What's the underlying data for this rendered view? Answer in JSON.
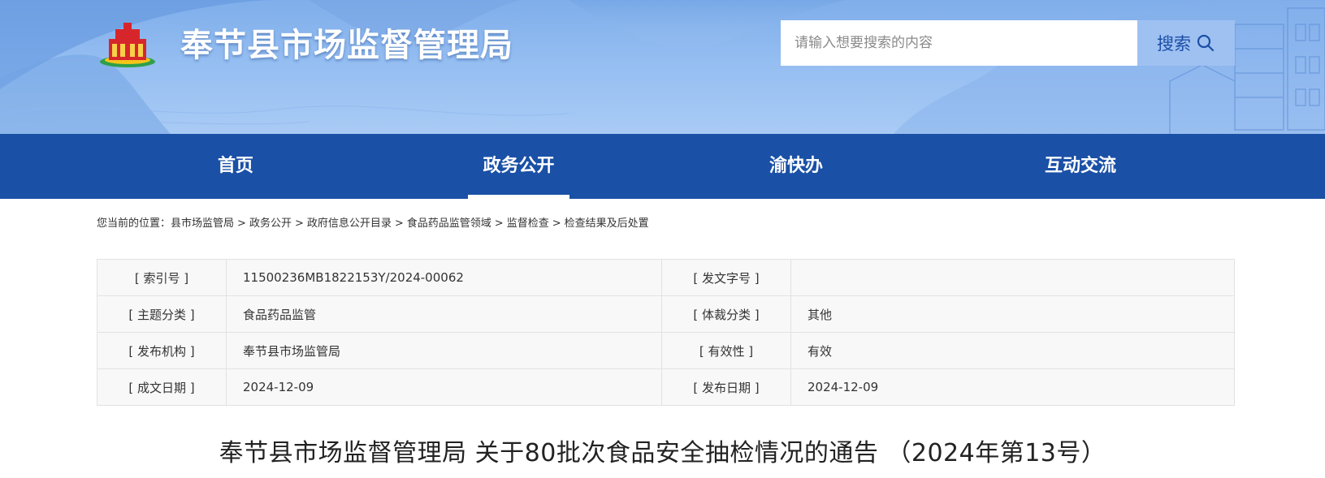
{
  "site": {
    "title": "奉节县市场监督管理局"
  },
  "search": {
    "placeholder": "请输入想要搜索的内容",
    "button_label": "搜索"
  },
  "nav": {
    "items": [
      {
        "label": "首页",
        "active": false
      },
      {
        "label": "政务公开",
        "active": true
      },
      {
        "label": "渝快办",
        "active": false
      },
      {
        "label": "互动交流",
        "active": false
      }
    ]
  },
  "breadcrumb": {
    "prefix": "您当前的位置：",
    "items": [
      "县市场监管局",
      "政务公开",
      "政府信息公开目录",
      "食品药品监管领域",
      "监督检查",
      "检查结果及后处置"
    ],
    "separator": ">"
  },
  "meta": {
    "rows": [
      {
        "label1": "[ 索引号 ]",
        "value1": "11500236MB1822153Y/2024-00062",
        "label2": "[ 发文字号 ]",
        "value2": ""
      },
      {
        "label1": "[ 主题分类 ]",
        "value1": "食品药品监管",
        "label2": "[ 体裁分类 ]",
        "value2": "其他"
      },
      {
        "label1": "[ 发布机构 ]",
        "value1": "奉节县市场监管局",
        "label2": "[ 有效性 ]",
        "value2": "有效"
      },
      {
        "label1": "[ 成文日期 ]",
        "value1": "2024-12-09",
        "label2": "[ 发布日期 ]",
        "value2": "2024-12-09"
      }
    ]
  },
  "article": {
    "title": "奉节县市场监督管理局 关于80批次食品安全抽检情况的通告 （2024年第13号）"
  },
  "colors": {
    "nav_bg": "#1a50a6",
    "banner_bg": "#94bdf1",
    "search_button_bg": "#9fc1f2",
    "table_cell_bg": "#f8f8f8"
  },
  "icons": {
    "logo": "emblem-logo-icon",
    "search": "search-icon"
  }
}
